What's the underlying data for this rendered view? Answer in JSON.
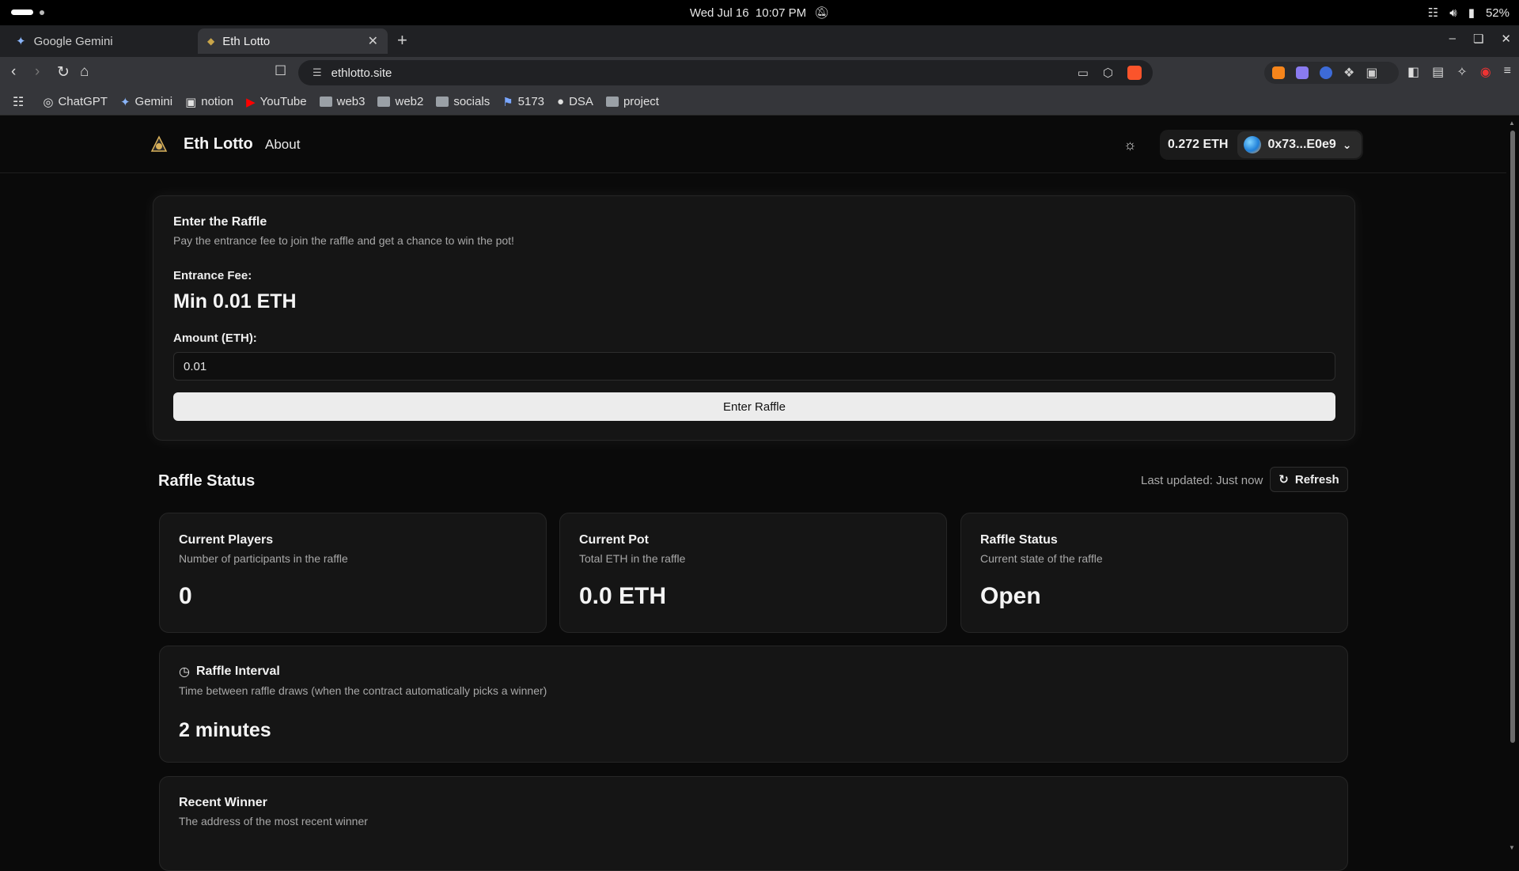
{
  "os": {
    "datetime": "Wed Jul 16  10:07 PM",
    "battery": "52%"
  },
  "browser": {
    "tabs": [
      {
        "label": "Google Gemini"
      },
      {
        "label": "Eth Lotto"
      }
    ],
    "url": "ethlotto.site",
    "bookmarks": [
      {
        "label": "ChatGPT",
        "icon": "chatgpt-icon"
      },
      {
        "label": "Gemini",
        "icon": "gemini-icon"
      },
      {
        "label": "notion",
        "icon": "notion-icon"
      },
      {
        "label": "YouTube",
        "icon": "youtube-icon"
      },
      {
        "label": "web3",
        "icon": "folder-icon"
      },
      {
        "label": "web2",
        "icon": "folder-icon"
      },
      {
        "label": "socials",
        "icon": "folder-icon"
      },
      {
        "label": "5173",
        "icon": "site-icon"
      },
      {
        "label": "DSA",
        "icon": "site-icon"
      },
      {
        "label": "project",
        "icon": "folder-icon"
      }
    ]
  },
  "header": {
    "brand": "Eth Lotto",
    "nav_about": "About",
    "balance": "0.272 ETH",
    "account": "0x73...E0e9"
  },
  "enter_raffle": {
    "title": "Enter the Raffle",
    "description": "Pay the entrance fee to join the raffle and get a chance to win the pot!",
    "fee_label": "Entrance Fee:",
    "fee_value": "Min 0.01 ETH",
    "amount_label": "Amount (ETH):",
    "amount_value": "0.01",
    "button_label": "Enter Raffle"
  },
  "status": {
    "title": "Raffle Status",
    "last_updated": "Last updated: Just now",
    "refresh_label": "Refresh",
    "cards": [
      {
        "title": "Current Players",
        "description": "Number of participants in the raffle",
        "value": "0"
      },
      {
        "title": "Current Pot",
        "description": "Total ETH in the raffle",
        "value": "0.0 ETH"
      },
      {
        "title": "Raffle Status",
        "description": "Current state of the raffle",
        "value": "Open"
      }
    ],
    "interval": {
      "title": "Raffle Interval",
      "description": "Time between raffle draws (when the contract automatically picks a winner)",
      "value": "2 minutes"
    },
    "recent_winner": {
      "title": "Recent Winner",
      "description": "The address of the most recent winner"
    }
  },
  "colors": {
    "background": "#0a0a0a",
    "card": "#151515",
    "primary_button": "#ececec"
  }
}
